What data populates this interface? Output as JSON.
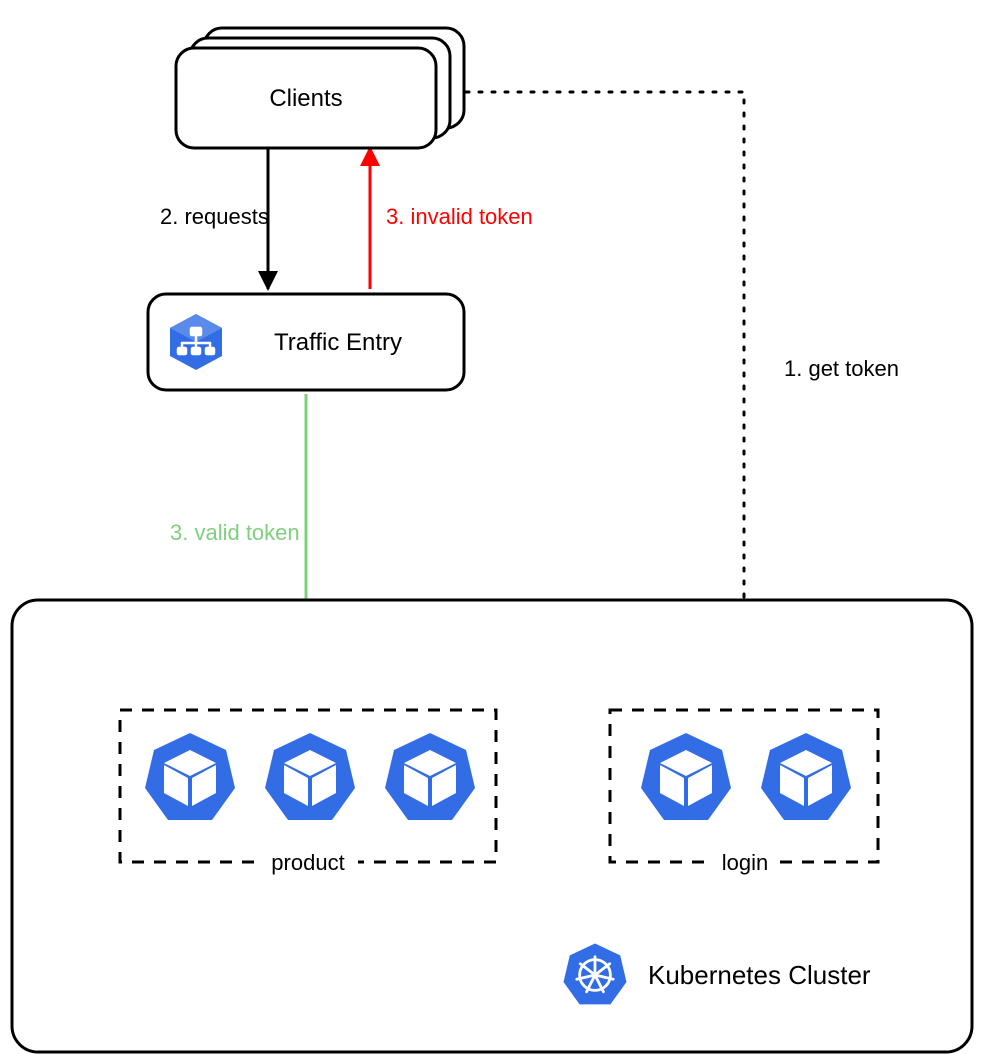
{
  "nodes": {
    "clients": {
      "label": "Clients"
    },
    "traffic_entry": {
      "label": "Traffic Entry"
    },
    "cluster": {
      "label": "Kubernetes Cluster"
    }
  },
  "groups": {
    "product": {
      "label": "product",
      "pod_count": 3
    },
    "login": {
      "label": "login",
      "pod_count": 2
    }
  },
  "edges": {
    "get_token": {
      "label": "1. get token",
      "color": "#000000",
      "style": "dotted"
    },
    "requests": {
      "label": "2. requests",
      "color": "#000000",
      "style": "solid"
    },
    "invalid_token": {
      "label": "3. invalid token",
      "color": "#ff0000",
      "style": "solid"
    },
    "valid_token": {
      "label": "3. valid token",
      "color": "#7ed07e",
      "style": "solid"
    }
  },
  "colors": {
    "icon_blue": "#326de6",
    "green": "#7ed07e",
    "red": "#ff0000",
    "black": "#000000"
  }
}
